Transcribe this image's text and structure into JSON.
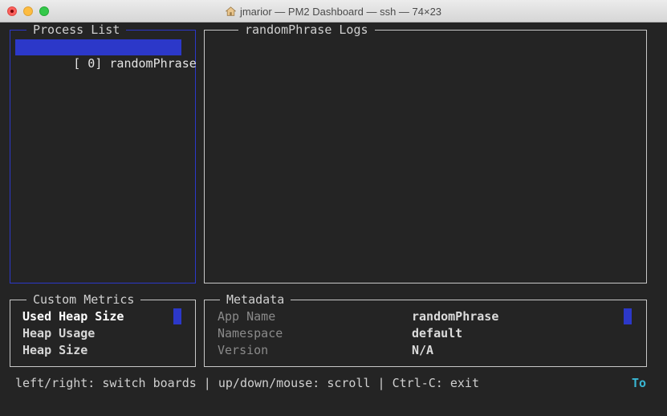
{
  "window": {
    "title": "jmarior — PM2 Dashboard — ssh — 74×23"
  },
  "process_list": {
    "title": "Process List",
    "items": [
      {
        "label": "[ 0] randomPhrase"
      }
    ]
  },
  "logs": {
    "title": "randomPhrase Logs"
  },
  "custom_metrics": {
    "title": "Custom Metrics",
    "items": [
      "Used Heap Size",
      "Heap Usage",
      "Heap Size"
    ]
  },
  "metadata": {
    "title": "Metadata",
    "rows": [
      {
        "key": "App Name",
        "value": "randomPhrase"
      },
      {
        "key": "Namespace",
        "value": "default"
      },
      {
        "key": "Version",
        "value": "N/A"
      }
    ]
  },
  "footer": {
    "help": "left/right: switch boards | up/down/mouse: scroll | Ctrl-C: exit",
    "corner": "To"
  },
  "colors": {
    "accent_blue": "#2c38c9",
    "corner_cyan": "#39b6d3",
    "background": "#242424"
  }
}
